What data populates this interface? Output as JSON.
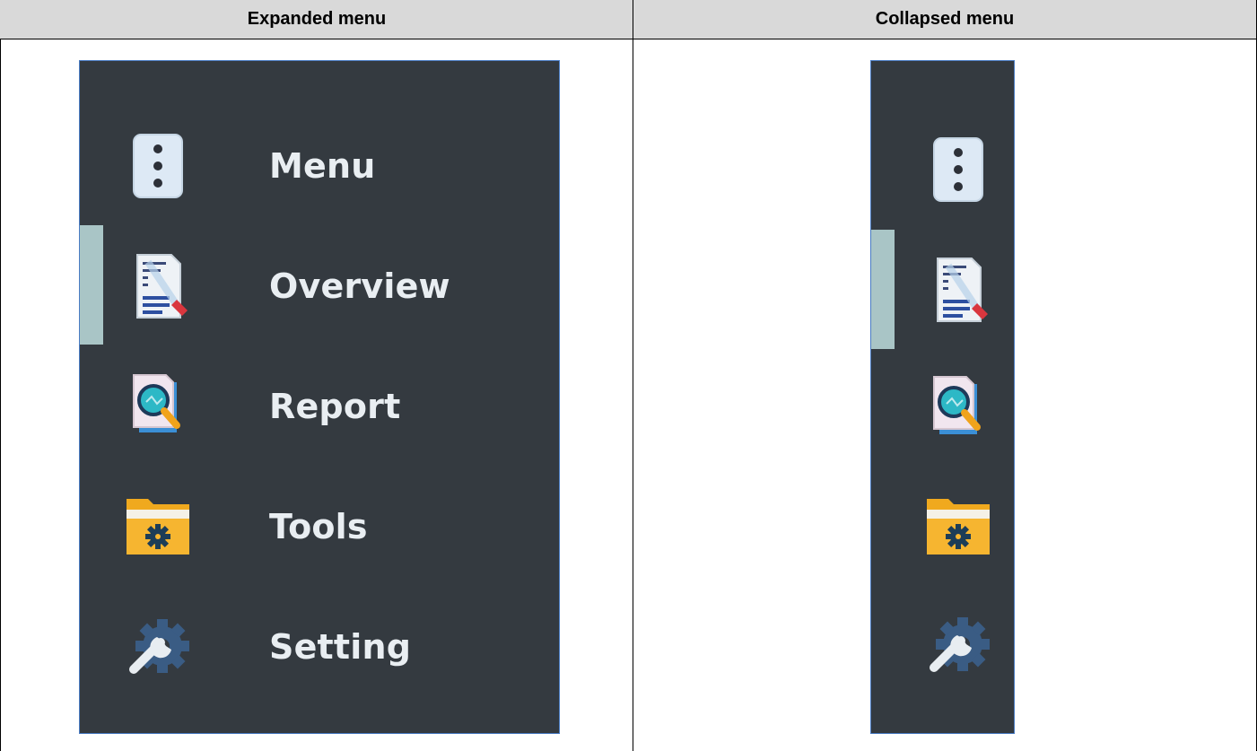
{
  "table": {
    "headers": [
      "Expanded menu",
      "Collapsed menu"
    ]
  },
  "expanded_menu": {
    "items": [
      {
        "label": "Menu",
        "icon": "kebab-menu-icon"
      },
      {
        "label": "Overview",
        "icon": "document-overview-icon",
        "active": true
      },
      {
        "label": "Report",
        "icon": "report-magnifier-icon"
      },
      {
        "label": "Tools",
        "icon": "folder-gear-icon"
      },
      {
        "label": "Setting",
        "icon": "wrench-gear-icon"
      }
    ]
  },
  "collapsed_menu": {
    "items": [
      {
        "icon": "kebab-menu-icon"
      },
      {
        "icon": "document-overview-icon",
        "active": true
      },
      {
        "icon": "report-magnifier-icon"
      },
      {
        "icon": "folder-gear-icon"
      },
      {
        "icon": "wrench-gear-icon"
      }
    ]
  },
  "colors": {
    "sidebar_bg": "#343a40",
    "sidebar_border": "#4a7cc4",
    "active_indicator": "#a9c5c6",
    "label_text": "#e9eef2",
    "header_bg": "#d9d9d9"
  }
}
